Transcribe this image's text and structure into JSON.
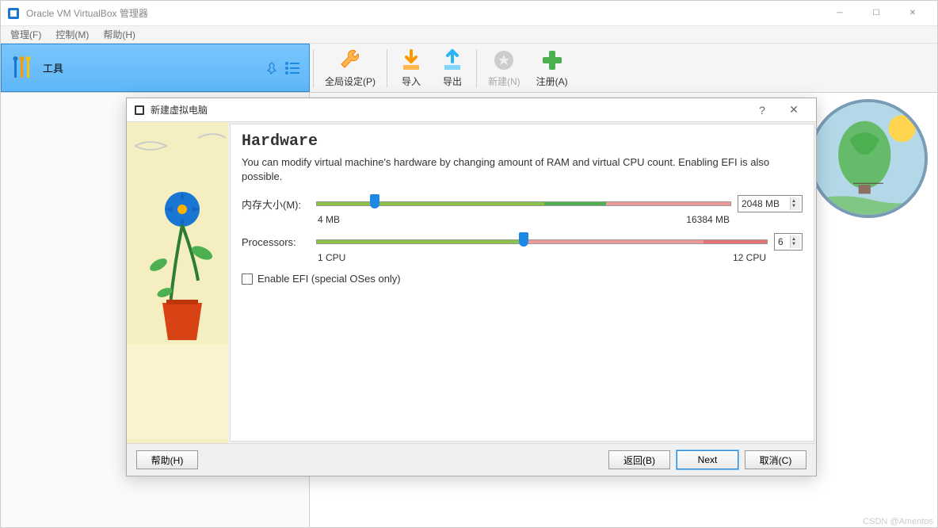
{
  "window": {
    "title": "Oracle VM VirtualBox 管理器"
  },
  "menubar": {
    "file": "管理(F)",
    "control": "控制(M)",
    "help": "帮助(H)"
  },
  "tools_button": {
    "label": "工具"
  },
  "toolbar": {
    "global_settings": "全局设定(P)",
    "import": "导入",
    "export": "导出",
    "new": "新建(N)",
    "register": "注册(A)"
  },
  "dialog": {
    "title": "新建虚拟电脑",
    "heading": "Hardware",
    "description": "You can modify virtual machine's hardware by changing amount of RAM and virtual CPU count. Enabling EFI is also possible.",
    "memory": {
      "label": "内存大小(M):",
      "min_label": "4 MB",
      "max_label": "16384 MB",
      "value": "2048 MB",
      "handle_pct": 14
    },
    "processors": {
      "label": "Processors:",
      "min_label": "1 CPU",
      "max_label": "12 CPU",
      "value": "6",
      "handle_pct": 46
    },
    "efi_label": "Enable EFI (special OSes only)",
    "buttons": {
      "help": "帮助(H)",
      "back": "返回(B)",
      "next": "Next",
      "cancel": "取消(C)"
    }
  },
  "watermark": "CSDN @Amentos"
}
